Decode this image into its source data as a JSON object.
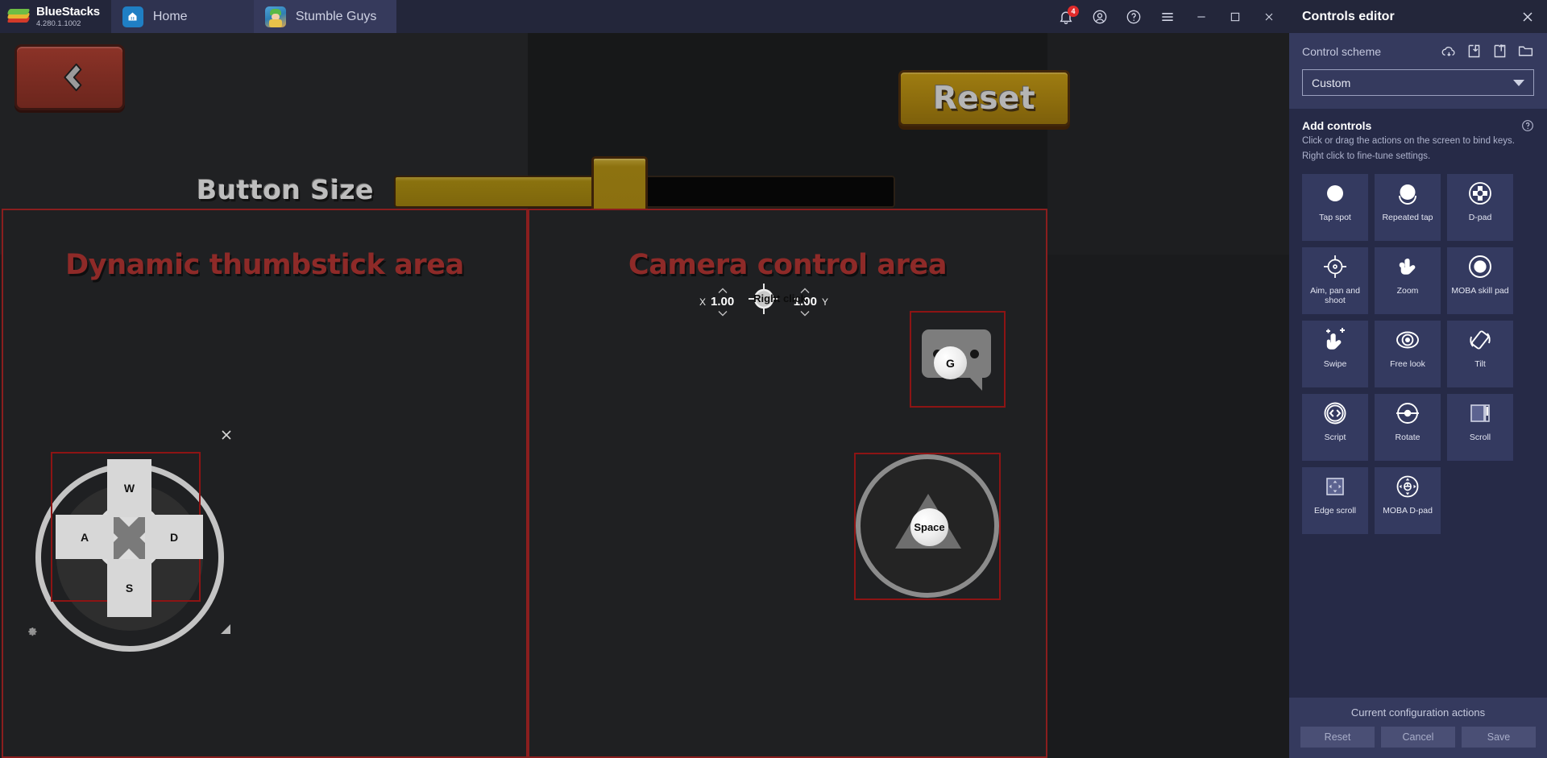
{
  "titlebar": {
    "brand": {
      "name": "BlueStacks",
      "version": "4.280.1.1002",
      "logo_icon": "bluestacks-logo-icon"
    },
    "tabs": [
      {
        "label": "Home",
        "icon": "home-icon"
      },
      {
        "label": "Stumble Guys",
        "icon": "stumble-guys-app-icon"
      }
    ],
    "icons": [
      {
        "name": "notifications-bell-icon",
        "badge": "4"
      },
      {
        "name": "account-icon"
      },
      {
        "name": "help-circle-icon"
      },
      {
        "name": "hamburger-menu-icon"
      }
    ],
    "window_buttons": [
      {
        "name": "minimize-button",
        "glyph": "—"
      },
      {
        "name": "maximize-button",
        "glyph": "□"
      },
      {
        "name": "close-button",
        "glyph": "×"
      }
    ]
  },
  "game": {
    "back_button": {
      "icon": "chevron-left-icon"
    },
    "reset_button": {
      "label": "Reset"
    },
    "button_size": {
      "label": "Button Size",
      "value_percent": 45,
      "min": 0,
      "max": 100
    },
    "areas": [
      {
        "name": "dynamic-thumbstick-area",
        "title": "Dynamic thumbstick area"
      },
      {
        "name": "camera-control-area",
        "title": "Camera control area"
      }
    ],
    "camera_sensitivity": {
      "x_label": "X",
      "x_value": "1.00",
      "y_label": "Y",
      "y_value": "1.00",
      "binding_label": "Right click",
      "icon": "crosshair-icon"
    },
    "controls": [
      {
        "name": "dpad-control",
        "type": "D-pad",
        "keys": {
          "up": "W",
          "left": "A",
          "down": "S",
          "right": "D"
        },
        "selected": true,
        "widgets": [
          "close-icon",
          "gear-icon",
          "resize-handle-icon"
        ]
      },
      {
        "name": "chat-tap-spot",
        "type": "Tap spot",
        "key": "G",
        "icon": "chat-bubble-icon",
        "selected": true
      },
      {
        "name": "jump-tap-spot",
        "type": "Tap spot",
        "key": "Space",
        "icon": "triangle-icon",
        "selected": true
      }
    ]
  },
  "panel": {
    "title": "Controls editor",
    "close_icon": "close-icon",
    "scheme": {
      "label": "Control scheme",
      "selected": "Custom",
      "actions": [
        {
          "name": "cloud-sync-icon"
        },
        {
          "name": "import-scheme-icon"
        },
        {
          "name": "export-scheme-icon"
        },
        {
          "name": "open-folder-icon"
        }
      ]
    },
    "add_controls": {
      "title": "Add controls",
      "help_icon": "help-circle-icon",
      "description_line1": "Click or drag the actions on the screen to bind keys.",
      "description_line2": "Right click to fine-tune settings.",
      "items": [
        {
          "label": "Tap spot",
          "icon": "tap-spot-icon"
        },
        {
          "label": "Repeated tap",
          "icon": "repeated-tap-icon"
        },
        {
          "label": "D-pad",
          "icon": "d-pad-icon"
        },
        {
          "label": "Aim, pan and shoot",
          "icon": "aim-pan-shoot-icon"
        },
        {
          "label": "Zoom",
          "icon": "zoom-pinch-icon"
        },
        {
          "label": "MOBA skill pad",
          "icon": "moba-skill-pad-icon"
        },
        {
          "label": "Swipe",
          "icon": "swipe-icon"
        },
        {
          "label": "Free look",
          "icon": "free-look-icon"
        },
        {
          "label": "Tilt",
          "icon": "tilt-icon"
        },
        {
          "label": "Script",
          "icon": "script-icon"
        },
        {
          "label": "Rotate",
          "icon": "rotate-icon"
        },
        {
          "label": "Scroll",
          "icon": "scroll-icon"
        },
        {
          "label": "Edge scroll",
          "icon": "edge-scroll-icon"
        },
        {
          "label": "MOBA D-pad",
          "icon": "moba-d-pad-icon"
        }
      ]
    },
    "footer": {
      "caption": "Current configuration actions",
      "reset_label": "Reset",
      "cancel_label": "Cancel",
      "save_label": "Save"
    }
  },
  "colors": {
    "panel_bg": "#262a47",
    "panel_header": "#23263a",
    "panel_section": "#353a5e",
    "cell_bg": "#343a60",
    "area_border": "#8a1e1e",
    "accent_gold": "#8d7210",
    "badge_red": "#e02b2b"
  }
}
